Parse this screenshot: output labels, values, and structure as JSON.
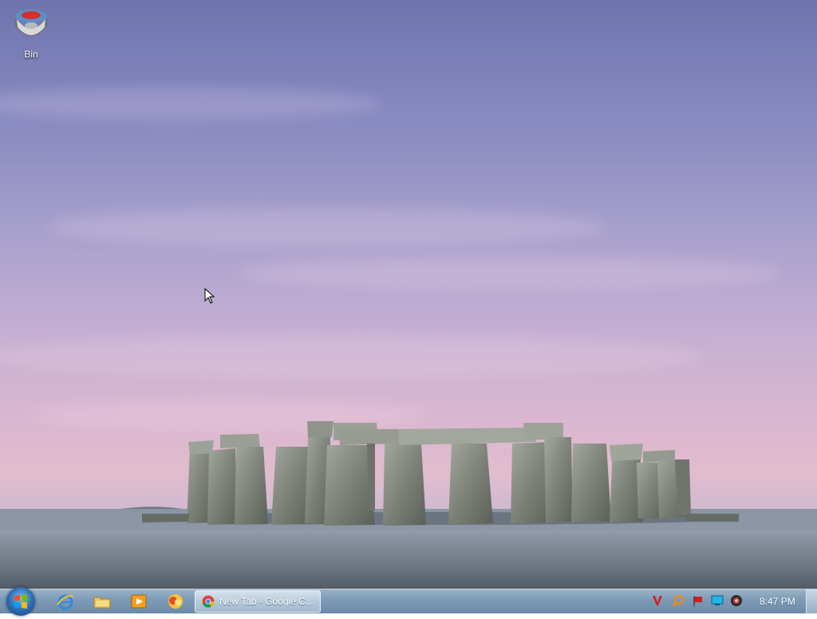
{
  "desktop": {
    "icons": [
      {
        "label": "Bin",
        "icon": "recycle-bin-icon"
      }
    ]
  },
  "taskbar": {
    "start": {
      "icon": "windows-start-orb-icon"
    },
    "pinned": [
      {
        "icon": "internet-explorer-icon"
      },
      {
        "icon": "windows-explorer-folder-icon"
      },
      {
        "icon": "media-player-icon"
      },
      {
        "icon": "app-icon"
      }
    ],
    "windows": [
      {
        "title": "New Tab - Google C...",
        "icon": "google-chrome-icon"
      }
    ],
    "tray": [
      {
        "icon": "antivirus-v-icon"
      },
      {
        "icon": "search-magnifier-icon"
      },
      {
        "icon": "action-center-flag-icon"
      },
      {
        "icon": "network-monitor-icon"
      },
      {
        "icon": "volume-icon"
      }
    ],
    "clock": "8:47 PM"
  },
  "colors": {
    "sky_top": "#6f74ad",
    "sky_bottom": "#e2bccd",
    "taskbar": "#7f9cb7",
    "stone": "#8a8f89"
  }
}
